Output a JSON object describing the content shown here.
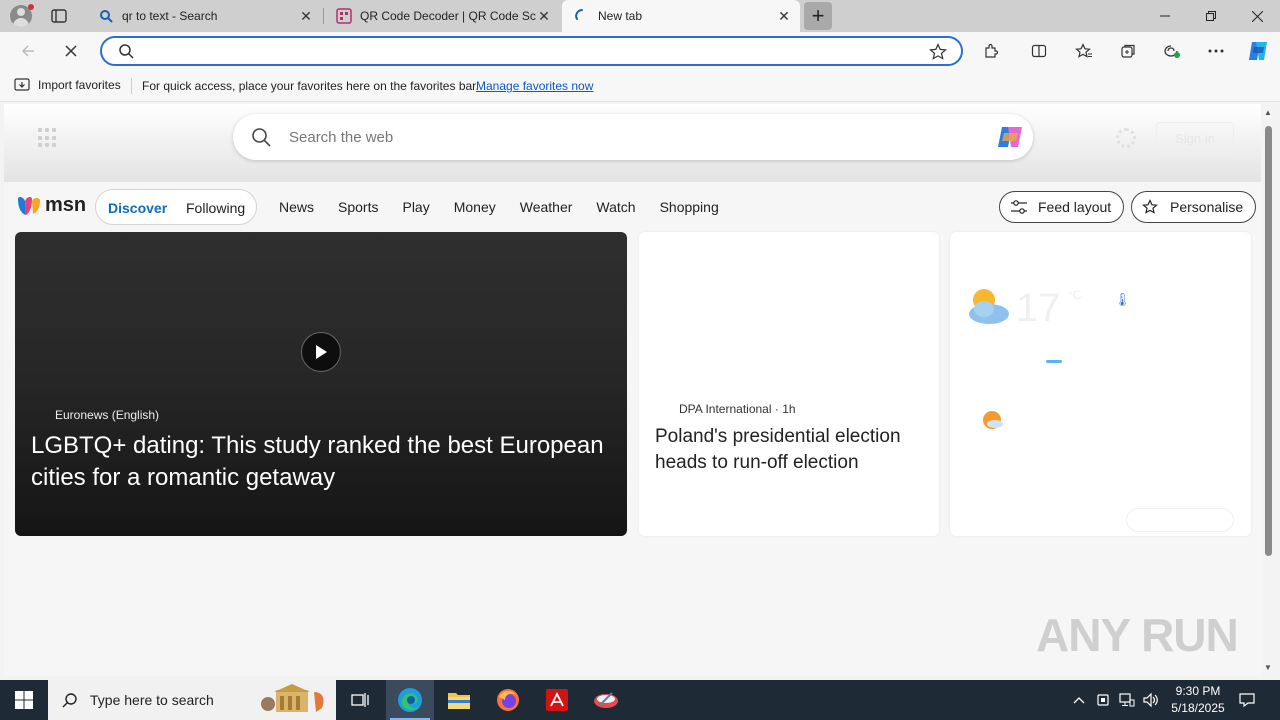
{
  "browser": {
    "tabs": [
      {
        "title": "qr to text - Search",
        "active": false
      },
      {
        "title": "QR Code Decoder | QR Code Scanner",
        "active": false
      },
      {
        "title": "New tab",
        "active": true
      }
    ],
    "address_bar": {
      "value": ""
    },
    "favorites_bar": {
      "import_label": "Import favorites",
      "message": "For quick access, place your favorites here on the favorites bar.",
      "link": "Manage favorites now"
    }
  },
  "newtab": {
    "search_placeholder": "Search the web",
    "sign_in": "Sign in",
    "msn_logo": "msn",
    "feed_tabs": {
      "discover": "Discover",
      "following": "Following"
    },
    "nav": [
      "News",
      "Sports",
      "Play",
      "Money",
      "Weather",
      "Watch",
      "Shopping"
    ],
    "feed_layout": "Feed layout",
    "personalise": "Personalise",
    "hero": {
      "source": "Euronews (English)",
      "title": "LGBTQ+ dating: This study ranked the best European cities for a romantic getaway"
    },
    "news": {
      "source": "DPA International",
      "age": "1h",
      "title": "Poland's presidential election heads to run-off election"
    },
    "weather": {
      "temp": "17",
      "unit": "°C"
    },
    "watermark": "ANY RUN"
  },
  "taskbar": {
    "search_placeholder": "Type here to search",
    "time": "9:30 PM",
    "date": "5/18/2025"
  },
  "colors": {
    "accent": "#0f6cbd",
    "address_border": "#2b6fd6",
    "taskbar": "#1f2a37"
  }
}
